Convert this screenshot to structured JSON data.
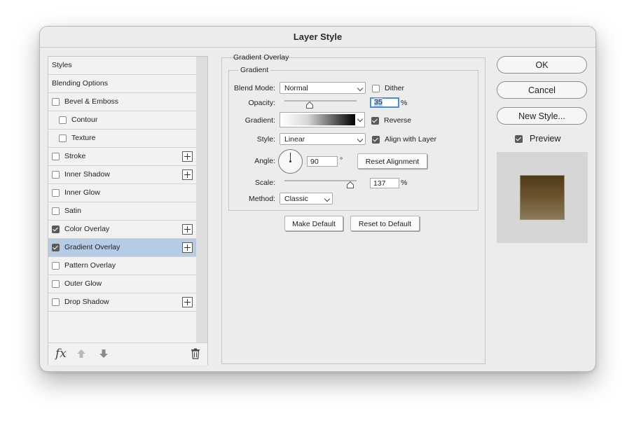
{
  "window": {
    "title": "Layer Style"
  },
  "styles_panel": {
    "items": [
      {
        "label": "Styles",
        "checkbox": null,
        "plus": false,
        "indent": 0
      },
      {
        "label": "Blending Options",
        "checkbox": null,
        "plus": false,
        "indent": 0
      },
      {
        "label": "Bevel & Emboss",
        "checkbox": false,
        "plus": false,
        "indent": 0
      },
      {
        "label": "Contour",
        "checkbox": false,
        "plus": false,
        "indent": 1
      },
      {
        "label": "Texture",
        "checkbox": false,
        "plus": false,
        "indent": 1
      },
      {
        "label": "Stroke",
        "checkbox": false,
        "plus": true,
        "indent": 0
      },
      {
        "label": "Inner Shadow",
        "checkbox": false,
        "plus": true,
        "indent": 0
      },
      {
        "label": "Inner Glow",
        "checkbox": false,
        "plus": false,
        "indent": 0
      },
      {
        "label": "Satin",
        "checkbox": false,
        "plus": false,
        "indent": 0
      },
      {
        "label": "Color Overlay",
        "checkbox": true,
        "plus": true,
        "indent": 0
      },
      {
        "label": "Gradient Overlay",
        "checkbox": true,
        "plus": true,
        "indent": 0,
        "selected": true
      },
      {
        "label": "Pattern Overlay",
        "checkbox": false,
        "plus": false,
        "indent": 0
      },
      {
        "label": "Outer Glow",
        "checkbox": false,
        "plus": false,
        "indent": 0
      },
      {
        "label": "Drop Shadow",
        "checkbox": false,
        "plus": true,
        "indent": 0
      }
    ],
    "footer": {
      "fx_label": "fx"
    }
  },
  "gradient_overlay": {
    "group_title": "Gradient Overlay",
    "sub_title": "Gradient",
    "blend_mode_label": "Blend Mode:",
    "blend_mode_value": "Normal",
    "dither_label": "Dither",
    "dither_checked": false,
    "opacity_label": "Opacity:",
    "opacity_value": "35",
    "opacity_percent": 35,
    "opacity_unit": "%",
    "gradient_label": "Gradient:",
    "reverse_label": "Reverse",
    "reverse_checked": true,
    "style_label": "Style:",
    "style_value": "Linear",
    "align_label": "Align with Layer",
    "align_checked": true,
    "angle_label": "Angle:",
    "angle_value": "90",
    "angle_unit": "°",
    "reset_alignment_label": "Reset Alignment",
    "scale_label": "Scale:",
    "scale_value": "137",
    "scale_unit": "%",
    "method_label": "Method:",
    "method_value": "Classic",
    "make_default_label": "Make Default",
    "reset_default_label": "Reset to Default"
  },
  "right_panel": {
    "ok_label": "OK",
    "cancel_label": "Cancel",
    "new_style_label": "New Style...",
    "preview_label": "Preview",
    "preview_checked": true
  },
  "colors": {
    "selection": "#b6cce6",
    "focus": "#4a90d9",
    "preview_top": "#4f3a16",
    "preview_bottom": "#8b7a5a"
  }
}
